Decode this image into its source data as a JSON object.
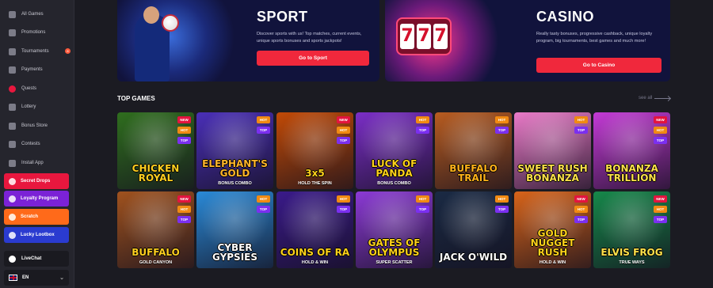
{
  "sidebar": {
    "items": [
      {
        "label": "All Games",
        "icon": "grid-icon"
      },
      {
        "label": "Promotions",
        "icon": "gift-icon"
      },
      {
        "label": "Tournaments",
        "icon": "trophy-icon",
        "badge": "8"
      },
      {
        "label": "Payments",
        "icon": "wallet-icon"
      },
      {
        "label": "Quests",
        "icon": "quest-icon"
      },
      {
        "label": "Lottery",
        "icon": "ticket-icon"
      },
      {
        "label": "Bonus Store",
        "icon": "store-icon"
      },
      {
        "label": "Contests",
        "icon": "contest-icon"
      },
      {
        "label": "Install App",
        "icon": "download-icon"
      }
    ],
    "promos": [
      {
        "label": "Secret Drops",
        "color": "#e8173e"
      },
      {
        "label": "Loyalty Program",
        "color": "#7b22d6"
      },
      {
        "label": "Scratch",
        "color": "#ff6a1a"
      },
      {
        "label": "Lucky Lootbox",
        "color": "#2a3bd0"
      }
    ],
    "livechat": "LiveChat",
    "language": "EN"
  },
  "banners": {
    "sport": {
      "title": "SPORT",
      "description": "Discover sports with us! Top matches, current events, unique sports bonuses and sports jackpots!",
      "button": "Go to Sport"
    },
    "casino": {
      "title": "CASINO",
      "description": "Really tasty bonuses, progressive cashback, unique loyalty program, big tournaments, best games and much more!",
      "button": "Go to Casino",
      "slot_digits": "777"
    }
  },
  "top_games": {
    "title": "TOP GAMES",
    "see_all": "see all",
    "games": [
      {
        "title": "CHICKEN ROYAL",
        "subtitle": "",
        "tags": [
          "NEW",
          "HOT",
          "TOP"
        ],
        "bg": "#2f6e1e",
        "color": "#ffcf1f"
      },
      {
        "title": "ELEPHANT'S GOLD",
        "subtitle": "BONUS COMBO",
        "tags": [
          "HOT",
          "TOP"
        ],
        "bg": "#4a2fb8",
        "color": "#ffb52a"
      },
      {
        "title": "3x5",
        "subtitle": "HOLD THE SPIN",
        "tags": [
          "NEW",
          "HOT",
          "TOP"
        ],
        "bg": "#c24a06",
        "color": "#ffd21a"
      },
      {
        "title": "LUCK OF PANDA",
        "subtitle": "BONUS COMBO",
        "tags": [
          "HOT",
          "TOP"
        ],
        "bg": "#7b2ec7",
        "color": "#ffd21a"
      },
      {
        "title": "BUFFALO TRAIL",
        "subtitle": "",
        "tags": [
          "HOT",
          "TOP"
        ],
        "bg": "#b85c20",
        "color": "#ffb21a"
      },
      {
        "title": "SWEET RUSH BONANZA",
        "subtitle": "",
        "tags": [
          "HOT",
          "TOP"
        ],
        "bg": "#ea7ac8",
        "color": "#ffe24a"
      },
      {
        "title": "BONANZA TRILLION",
        "subtitle": "",
        "tags": [
          "NEW",
          "HOT",
          "TOP"
        ],
        "bg": "#c43ad6",
        "color": "#ffe24a"
      },
      {
        "title": "BUFFALO",
        "subtitle": "GOLD CANYON",
        "tags": [
          "NEW",
          "HOT",
          "TOP"
        ],
        "bg": "#a0521e",
        "color": "#ffcf1f"
      },
      {
        "title": "CYBER GYPSIES",
        "subtitle": "",
        "tags": [
          "HOT",
          "TOP"
        ],
        "bg": "#2a8ad8",
        "color": "#ffffff"
      },
      {
        "title": "COINS OF RA",
        "subtitle": "HOLD & WIN",
        "tags": [
          "HOT",
          "TOP"
        ],
        "bg": "#3a1a8a",
        "color": "#ffd21a"
      },
      {
        "title": "GATES OF OLYMPUS",
        "subtitle": "SUPER SCATTER",
        "tags": [
          "HOT",
          "TOP"
        ],
        "bg": "#8c3ad6",
        "color": "#ffd21a"
      },
      {
        "title": "JACK O'WILD",
        "subtitle": "",
        "tags": [
          "HOT",
          "TOP"
        ],
        "bg": "#1a2a44",
        "color": "#ffffff"
      },
      {
        "title": "GOLD NUGGET RUSH",
        "subtitle": "HOLD & WIN",
        "tags": [
          "NEW",
          "HOT",
          "TOP"
        ],
        "bg": "#d8641a",
        "color": "#ffd21a"
      },
      {
        "title": "ELVIS FROG",
        "subtitle": "TRUE WAYS",
        "tags": [
          "NEW",
          "HOT",
          "TOP"
        ],
        "bg": "#16884a",
        "color": "#ffe24a"
      }
    ]
  }
}
